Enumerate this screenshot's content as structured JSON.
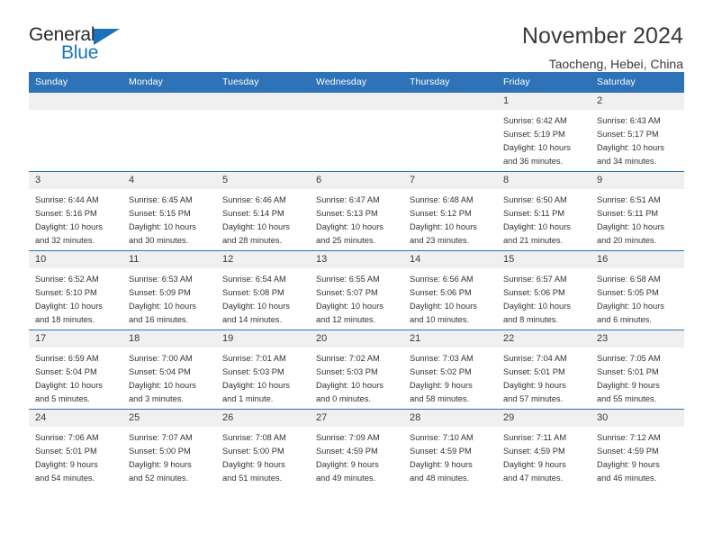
{
  "brand": {
    "name_part1": "General",
    "name_part2": "Blue",
    "accent_color": "#1a72bb"
  },
  "header": {
    "title": "November 2024",
    "subtitle": "Taocheng, Hebei, China"
  },
  "calendar": {
    "header_color": "#2e72b8",
    "daynum_band_color": "#f0f0f0",
    "weekday_headers": [
      "Sunday",
      "Monday",
      "Tuesday",
      "Wednesday",
      "Thursday",
      "Friday",
      "Saturday"
    ],
    "weeks": [
      [
        {
          "day": "",
          "empty": true,
          "sunrise": "",
          "sunset": "",
          "daylight_line1": "",
          "daylight_line2": ""
        },
        {
          "day": "",
          "empty": true,
          "sunrise": "",
          "sunset": "",
          "daylight_line1": "",
          "daylight_line2": ""
        },
        {
          "day": "",
          "empty": true,
          "sunrise": "",
          "sunset": "",
          "daylight_line1": "",
          "daylight_line2": ""
        },
        {
          "day": "",
          "empty": true,
          "sunrise": "",
          "sunset": "",
          "daylight_line1": "",
          "daylight_line2": ""
        },
        {
          "day": "",
          "empty": true,
          "sunrise": "",
          "sunset": "",
          "daylight_line1": "",
          "daylight_line2": ""
        },
        {
          "day": "1",
          "sunrise": "Sunrise: 6:42 AM",
          "sunset": "Sunset: 5:19 PM",
          "daylight_line1": "Daylight: 10 hours",
          "daylight_line2": "and 36 minutes."
        },
        {
          "day": "2",
          "sunrise": "Sunrise: 6:43 AM",
          "sunset": "Sunset: 5:17 PM",
          "daylight_line1": "Daylight: 10 hours",
          "daylight_line2": "and 34 minutes."
        }
      ],
      [
        {
          "day": "3",
          "sunrise": "Sunrise: 6:44 AM",
          "sunset": "Sunset: 5:16 PM",
          "daylight_line1": "Daylight: 10 hours",
          "daylight_line2": "and 32 minutes."
        },
        {
          "day": "4",
          "sunrise": "Sunrise: 6:45 AM",
          "sunset": "Sunset: 5:15 PM",
          "daylight_line1": "Daylight: 10 hours",
          "daylight_line2": "and 30 minutes."
        },
        {
          "day": "5",
          "sunrise": "Sunrise: 6:46 AM",
          "sunset": "Sunset: 5:14 PM",
          "daylight_line1": "Daylight: 10 hours",
          "daylight_line2": "and 28 minutes."
        },
        {
          "day": "6",
          "sunrise": "Sunrise: 6:47 AM",
          "sunset": "Sunset: 5:13 PM",
          "daylight_line1": "Daylight: 10 hours",
          "daylight_line2": "and 25 minutes."
        },
        {
          "day": "7",
          "sunrise": "Sunrise: 6:48 AM",
          "sunset": "Sunset: 5:12 PM",
          "daylight_line1": "Daylight: 10 hours",
          "daylight_line2": "and 23 minutes."
        },
        {
          "day": "8",
          "sunrise": "Sunrise: 6:50 AM",
          "sunset": "Sunset: 5:11 PM",
          "daylight_line1": "Daylight: 10 hours",
          "daylight_line2": "and 21 minutes."
        },
        {
          "day": "9",
          "sunrise": "Sunrise: 6:51 AM",
          "sunset": "Sunset: 5:11 PM",
          "daylight_line1": "Daylight: 10 hours",
          "daylight_line2": "and 20 minutes."
        }
      ],
      [
        {
          "day": "10",
          "sunrise": "Sunrise: 6:52 AM",
          "sunset": "Sunset: 5:10 PM",
          "daylight_line1": "Daylight: 10 hours",
          "daylight_line2": "and 18 minutes."
        },
        {
          "day": "11",
          "sunrise": "Sunrise: 6:53 AM",
          "sunset": "Sunset: 5:09 PM",
          "daylight_line1": "Daylight: 10 hours",
          "daylight_line2": "and 16 minutes."
        },
        {
          "day": "12",
          "sunrise": "Sunrise: 6:54 AM",
          "sunset": "Sunset: 5:08 PM",
          "daylight_line1": "Daylight: 10 hours",
          "daylight_line2": "and 14 minutes."
        },
        {
          "day": "13",
          "sunrise": "Sunrise: 6:55 AM",
          "sunset": "Sunset: 5:07 PM",
          "daylight_line1": "Daylight: 10 hours",
          "daylight_line2": "and 12 minutes."
        },
        {
          "day": "14",
          "sunrise": "Sunrise: 6:56 AM",
          "sunset": "Sunset: 5:06 PM",
          "daylight_line1": "Daylight: 10 hours",
          "daylight_line2": "and 10 minutes."
        },
        {
          "day": "15",
          "sunrise": "Sunrise: 6:57 AM",
          "sunset": "Sunset: 5:06 PM",
          "daylight_line1": "Daylight: 10 hours",
          "daylight_line2": "and 8 minutes."
        },
        {
          "day": "16",
          "sunrise": "Sunrise: 6:58 AM",
          "sunset": "Sunset: 5:05 PM",
          "daylight_line1": "Daylight: 10 hours",
          "daylight_line2": "and 6 minutes."
        }
      ],
      [
        {
          "day": "17",
          "sunrise": "Sunrise: 6:59 AM",
          "sunset": "Sunset: 5:04 PM",
          "daylight_line1": "Daylight: 10 hours",
          "daylight_line2": "and 5 minutes."
        },
        {
          "day": "18",
          "sunrise": "Sunrise: 7:00 AM",
          "sunset": "Sunset: 5:04 PM",
          "daylight_line1": "Daylight: 10 hours",
          "daylight_line2": "and 3 minutes."
        },
        {
          "day": "19",
          "sunrise": "Sunrise: 7:01 AM",
          "sunset": "Sunset: 5:03 PM",
          "daylight_line1": "Daylight: 10 hours",
          "daylight_line2": "and 1 minute."
        },
        {
          "day": "20",
          "sunrise": "Sunrise: 7:02 AM",
          "sunset": "Sunset: 5:03 PM",
          "daylight_line1": "Daylight: 10 hours",
          "daylight_line2": "and 0 minutes."
        },
        {
          "day": "21",
          "sunrise": "Sunrise: 7:03 AM",
          "sunset": "Sunset: 5:02 PM",
          "daylight_line1": "Daylight: 9 hours",
          "daylight_line2": "and 58 minutes."
        },
        {
          "day": "22",
          "sunrise": "Sunrise: 7:04 AM",
          "sunset": "Sunset: 5:01 PM",
          "daylight_line1": "Daylight: 9 hours",
          "daylight_line2": "and 57 minutes."
        },
        {
          "day": "23",
          "sunrise": "Sunrise: 7:05 AM",
          "sunset": "Sunset: 5:01 PM",
          "daylight_line1": "Daylight: 9 hours",
          "daylight_line2": "and 55 minutes."
        }
      ],
      [
        {
          "day": "24",
          "sunrise": "Sunrise: 7:06 AM",
          "sunset": "Sunset: 5:01 PM",
          "daylight_line1": "Daylight: 9 hours",
          "daylight_line2": "and 54 minutes."
        },
        {
          "day": "25",
          "sunrise": "Sunrise: 7:07 AM",
          "sunset": "Sunset: 5:00 PM",
          "daylight_line1": "Daylight: 9 hours",
          "daylight_line2": "and 52 minutes."
        },
        {
          "day": "26",
          "sunrise": "Sunrise: 7:08 AM",
          "sunset": "Sunset: 5:00 PM",
          "daylight_line1": "Daylight: 9 hours",
          "daylight_line2": "and 51 minutes."
        },
        {
          "day": "27",
          "sunrise": "Sunrise: 7:09 AM",
          "sunset": "Sunset: 4:59 PM",
          "daylight_line1": "Daylight: 9 hours",
          "daylight_line2": "and 49 minutes."
        },
        {
          "day": "28",
          "sunrise": "Sunrise: 7:10 AM",
          "sunset": "Sunset: 4:59 PM",
          "daylight_line1": "Daylight: 9 hours",
          "daylight_line2": "and 48 minutes."
        },
        {
          "day": "29",
          "sunrise": "Sunrise: 7:11 AM",
          "sunset": "Sunset: 4:59 PM",
          "daylight_line1": "Daylight: 9 hours",
          "daylight_line2": "and 47 minutes."
        },
        {
          "day": "30",
          "sunrise": "Sunrise: 7:12 AM",
          "sunset": "Sunset: 4:59 PM",
          "daylight_line1": "Daylight: 9 hours",
          "daylight_line2": "and 46 minutes."
        }
      ]
    ]
  }
}
